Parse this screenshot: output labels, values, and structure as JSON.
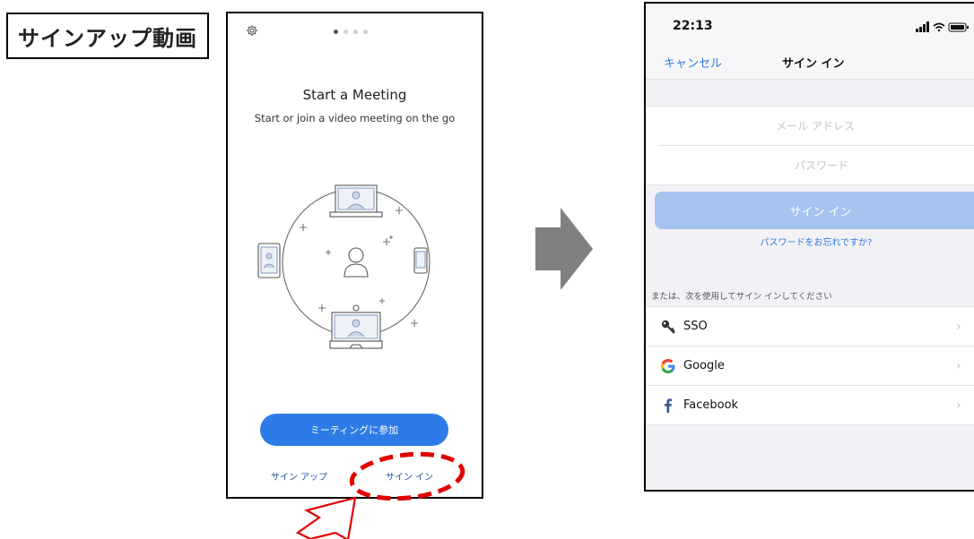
{
  "label": {
    "title": "サインアップ動画"
  },
  "onboarding": {
    "gear_icon": "gear-icon",
    "page_dots": {
      "count": 4,
      "active": 1
    },
    "title": "Start a Meeting",
    "subtitle": "Start or join a video meeting on the go",
    "join_button": "ミーティングに参加",
    "signup_link": "サイン アップ",
    "signin_link": "サイン イン",
    "accent_color": "#2D7BE6",
    "highlight_color": "#E00000"
  },
  "signin": {
    "status": {
      "time": "22:13"
    },
    "nav": {
      "cancel": "キャンセル",
      "title": "サイン イン"
    },
    "email_placeholder": "メール アドレス",
    "password_placeholder": "パスワード",
    "signin_button": "サイン イン",
    "forgot": "パスワードをお忘れですか?",
    "or_label": "または、次を使用してサイン インしてください",
    "options": [
      {
        "label": "SSO",
        "icon": "key-icon"
      },
      {
        "label": "Google",
        "icon": "google-icon"
      },
      {
        "label": "Facebook",
        "icon": "facebook-icon"
      }
    ],
    "accent_color": "#2B78E4"
  }
}
